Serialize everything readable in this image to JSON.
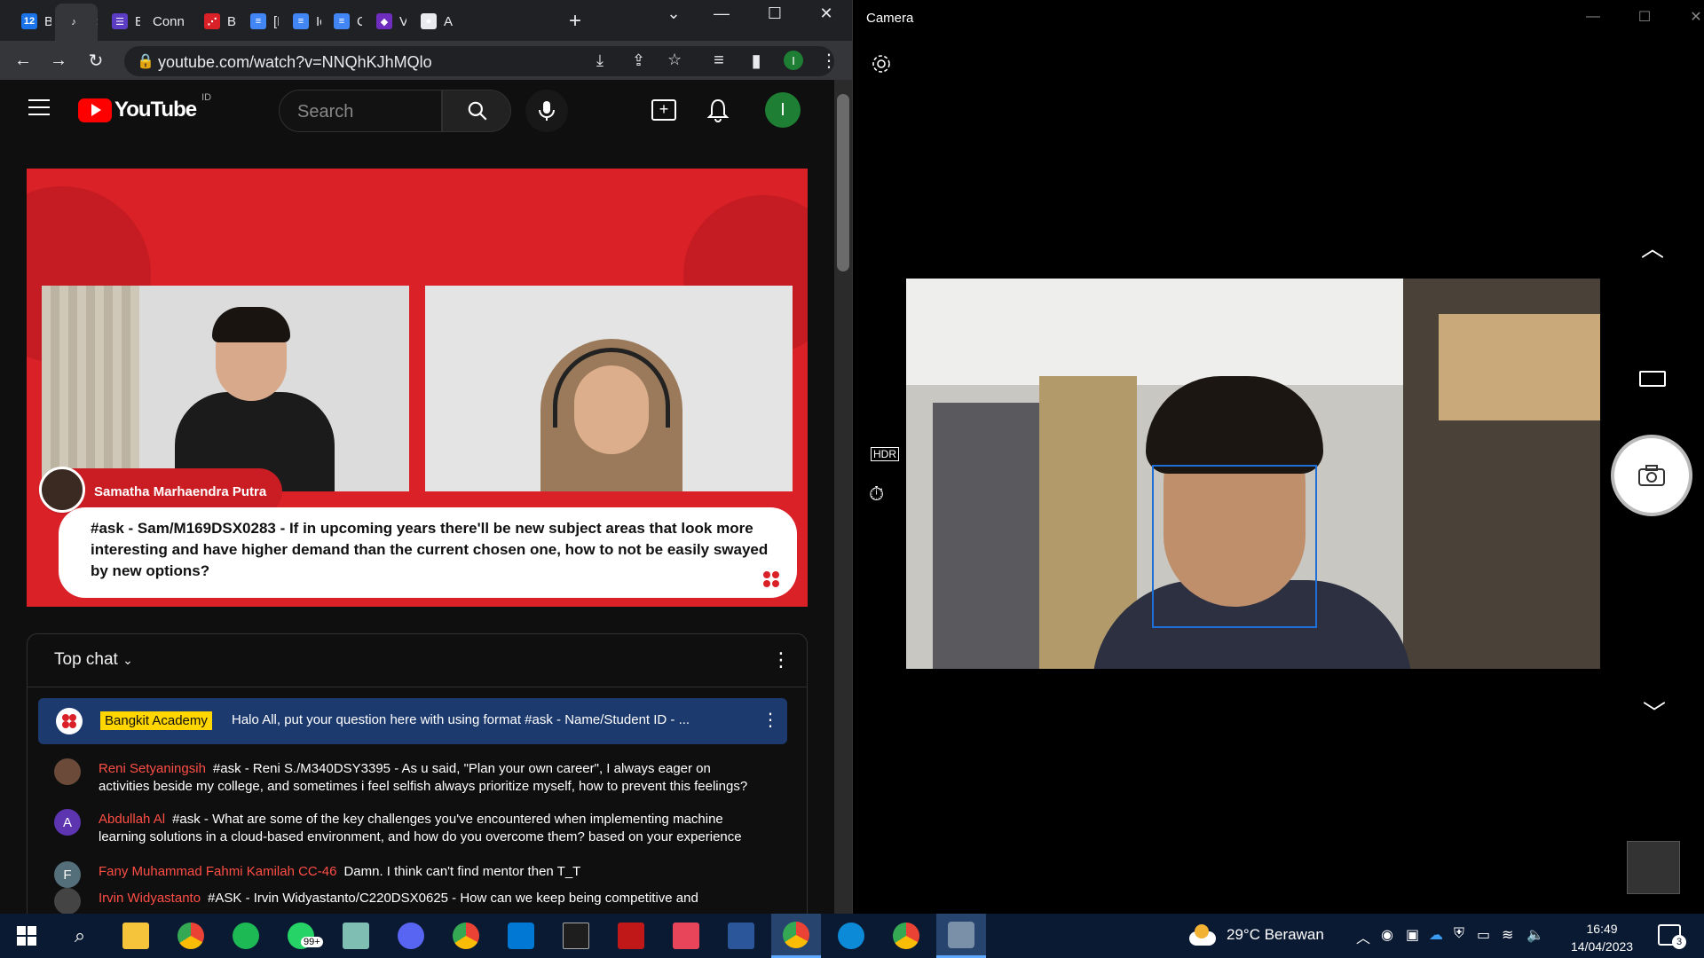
{
  "browser": {
    "tabs": [
      {
        "label": "B",
        "color": "#1a73e8",
        "glyph": "12"
      },
      {
        "label": "",
        "color": "#35363a",
        "glyph": "♪",
        "active": true
      },
      {
        "label": "B",
        "color": "#5b3cc4",
        "glyph": "☰"
      },
      {
        "label": "Conn",
        "color": "",
        "glyph": ""
      },
      {
        "label": "B",
        "color": "#d92127",
        "glyph": "⋰"
      },
      {
        "label": "[E",
        "color": "#4285f4",
        "glyph": "≡"
      },
      {
        "label": "Ic",
        "color": "#4285f4",
        "glyph": "≡"
      },
      {
        "label": "C",
        "color": "#4285f4",
        "glyph": "≡"
      },
      {
        "label": "V",
        "color": "#6f2dbd",
        "glyph": "◆"
      },
      {
        "label": "A",
        "color": "#e8eaed",
        "glyph": "●"
      }
    ],
    "new_tab": "+",
    "url": "youtube.com/watch?v=NNQhKJhMQlo",
    "profile_initial": "I"
  },
  "youtube": {
    "logo_text": "YouTube",
    "country_code": "ID",
    "search_placeholder": "Search",
    "avatar_initial": "I",
    "video": {
      "speaker_name": "Samatha Marhaendra Putra",
      "question": "#ask - Sam/M169DSX0283 - If in upcoming years there'll be new subject areas that look more interesting and have higher demand than the current chosen one, how to not be easily swayed by new options?"
    },
    "chat": {
      "title": "Top chat",
      "pinned": {
        "author": "Bangkit Academy",
        "message": "Halo All, put your question here with using format #ask - Name/Student ID - ..."
      },
      "messages": [
        {
          "author": "Reni Setyaningsih",
          "text": "#ask - Reni S./M340DSY3395 - As u said, \"Plan your own career\", I always eager on activities beside my college, and sometimes i feel selfish always prioritize myself, how to prevent this feelings?",
          "avatar": "",
          "avatar_color": "#6b4a3a"
        },
        {
          "author": "Abdullah Al",
          "text": "#ask - What are some of the key challenges you've encountered when implementing machine learning solutions in a cloud-based environment, and how do you overcome them? based on your experience",
          "avatar": "A",
          "avatar_color": "#5e35b1"
        },
        {
          "author": "Fany Muhammad Fahmi Kamilah CC-46",
          "text": "Damn. I think can't find mentor then T_T",
          "avatar": "F",
          "avatar_color": "#546e7a"
        },
        {
          "author": "Irvin Widyastanto",
          "text": "#ASK - Irvin Widyastanto/C220DSX0625 - How can we keep being competitive and",
          "avatar": "",
          "avatar_color": "#444"
        }
      ]
    }
  },
  "camera": {
    "title": "Camera"
  },
  "taskbar": {
    "weather": "29°C  Berawan",
    "time": "16:49",
    "date": "14/04/2023",
    "whatsapp_badge": "99+",
    "notification_count": "3"
  }
}
